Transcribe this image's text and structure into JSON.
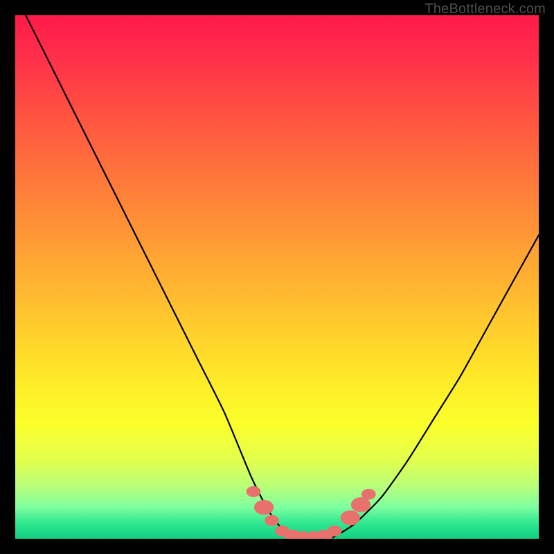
{
  "attribution": "TheBottleneck.com",
  "colors": {
    "frame": "#000000",
    "curve_stroke": "#000000",
    "marker_fill": "#e9716d",
    "marker_stroke": "#e9716d",
    "gradient_top": "#ff1a4a",
    "gradient_bottom": "#10d084"
  },
  "chart_data": {
    "type": "line",
    "title": "",
    "xlabel": "",
    "ylabel": "",
    "xlim": [
      0,
      100
    ],
    "ylim": [
      0,
      100
    ],
    "grid": false,
    "series": [
      {
        "name": "bottleneck_curve",
        "x": [
          2,
          5,
          10,
          15,
          20,
          25,
          30,
          35,
          40,
          45,
          48,
          50,
          52,
          55,
          58,
          60,
          62,
          65,
          70,
          75,
          80,
          85,
          90,
          95,
          100
        ],
        "y": [
          100,
          94,
          84,
          74,
          64,
          54,
          44,
          34,
          24,
          12,
          6,
          3,
          1,
          0,
          0,
          0,
          1,
          3,
          8,
          15,
          23,
          31,
          40,
          49,
          58
        ]
      }
    ],
    "markers": [
      {
        "x": 45.5,
        "y": 9.0,
        "r": 1.1
      },
      {
        "x": 47.5,
        "y": 6.0,
        "r": 1.5
      },
      {
        "x": 49.0,
        "y": 3.5,
        "r": 1.1
      },
      {
        "x": 51.0,
        "y": 1.5,
        "r": 1.1
      },
      {
        "x": 53.0,
        "y": 0.5,
        "r": 1.3
      },
      {
        "x": 55.0,
        "y": 0.2,
        "r": 1.3
      },
      {
        "x": 57.0,
        "y": 0.2,
        "r": 1.3
      },
      {
        "x": 59.0,
        "y": 0.5,
        "r": 1.3
      },
      {
        "x": 61.0,
        "y": 1.5,
        "r": 1.1
      },
      {
        "x": 64.0,
        "y": 4.0,
        "r": 1.5
      },
      {
        "x": 66.0,
        "y": 6.5,
        "r": 1.5
      },
      {
        "x": 67.5,
        "y": 8.5,
        "r": 1.1
      }
    ]
  }
}
